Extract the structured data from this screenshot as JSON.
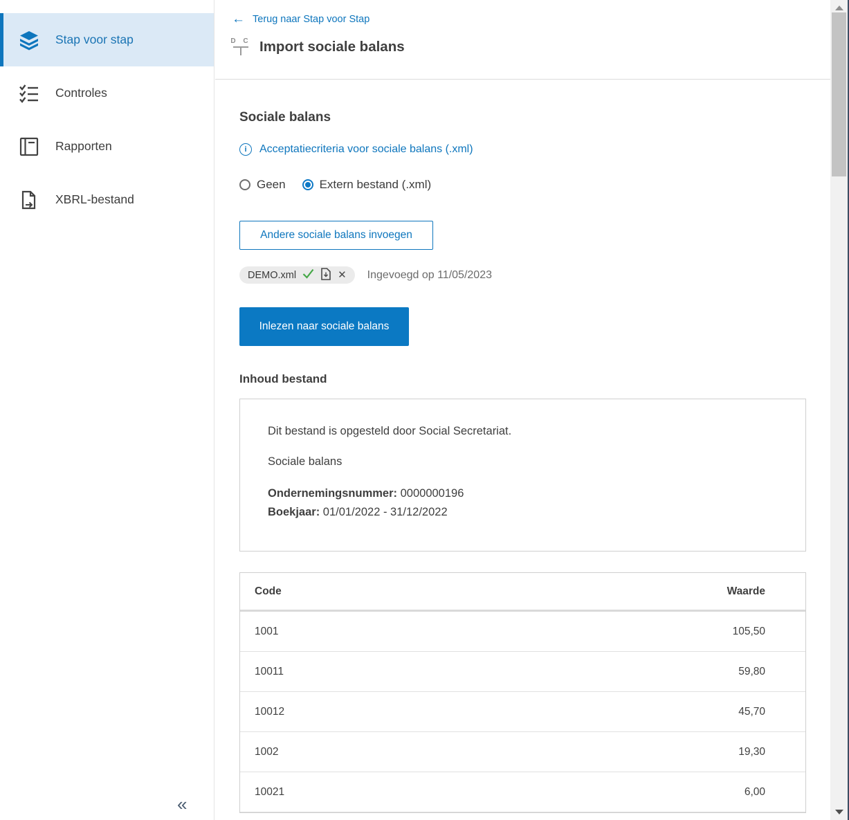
{
  "colors": {
    "accent_blue": "#0e76bd",
    "primary_button": "#0b79c3",
    "active_item_bg": "#dbe9f6",
    "check_green": "#45a847"
  },
  "icons": {
    "back_arrow": "←",
    "close": "✕",
    "collapse": "«",
    "info": "i",
    "title_letters": "D C"
  },
  "sidebar": {
    "items": [
      {
        "label": "Stap voor stap",
        "icon": "layers-icon",
        "active": true
      },
      {
        "label": "Controles",
        "icon": "checklist-icon",
        "active": false
      },
      {
        "label": "Rapporten",
        "icon": "report-icon",
        "active": false
      },
      {
        "label": "XBRL-bestand",
        "icon": "file-export-icon",
        "active": false
      }
    ]
  },
  "header": {
    "back_link": "Terug naar Stap voor Stap",
    "title": "Import sociale balans"
  },
  "main": {
    "section_title": "Sociale balans",
    "criteria_link": "Acceptatiecriteria voor sociale balans (.xml)",
    "radios": [
      {
        "label": "Geen",
        "selected": false
      },
      {
        "label": "Extern bestand (.xml)",
        "selected": true
      }
    ],
    "insert_button": "Andere sociale balans invoegen",
    "file_chip": {
      "name": "DEMO.xml"
    },
    "inserted_text": "Ingevoegd op 11/05/2023",
    "read_button": "Inlezen naar sociale balans",
    "content_heading": "Inhoud bestand",
    "file_content": {
      "line1": "Dit bestand is opgesteld door Social Secretariat.",
      "line2": "Sociale balans",
      "company_label": "Ondernemingsnummer:",
      "company_value": "0000000196",
      "year_label": "Boekjaar:",
      "year_value": "01/01/2022 - 31/12/2022"
    },
    "table": {
      "columns": [
        "Code",
        "Waarde"
      ],
      "rows": [
        [
          "1001",
          "105,50"
        ],
        [
          "10011",
          "59,80"
        ],
        [
          "10012",
          "45,70"
        ],
        [
          "1002",
          "19,30"
        ],
        [
          "10021",
          "6,00"
        ]
      ]
    }
  }
}
